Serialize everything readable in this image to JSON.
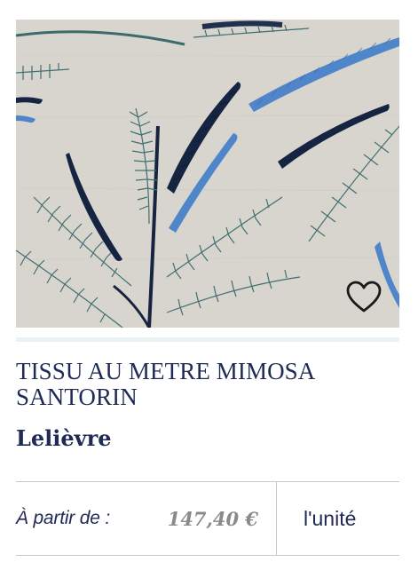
{
  "product": {
    "image_alt": "Mimosa Santorin embroidered fabric",
    "title": "TISSU AU METRE MIMOSA SANTORIN",
    "brand": "Lelièvre",
    "price_prefix": "À partir de :",
    "price": "147,40 €",
    "unit": "l'unité"
  },
  "icons": {
    "favorite": "heart-outline-icon"
  },
  "colors": {
    "text_navy": "#1f2a55",
    "price_gray": "#8a8a8a",
    "fabric_bg": "#d9d5cf",
    "divider": "#c9c9c9",
    "strip": "#eaf2f3"
  }
}
